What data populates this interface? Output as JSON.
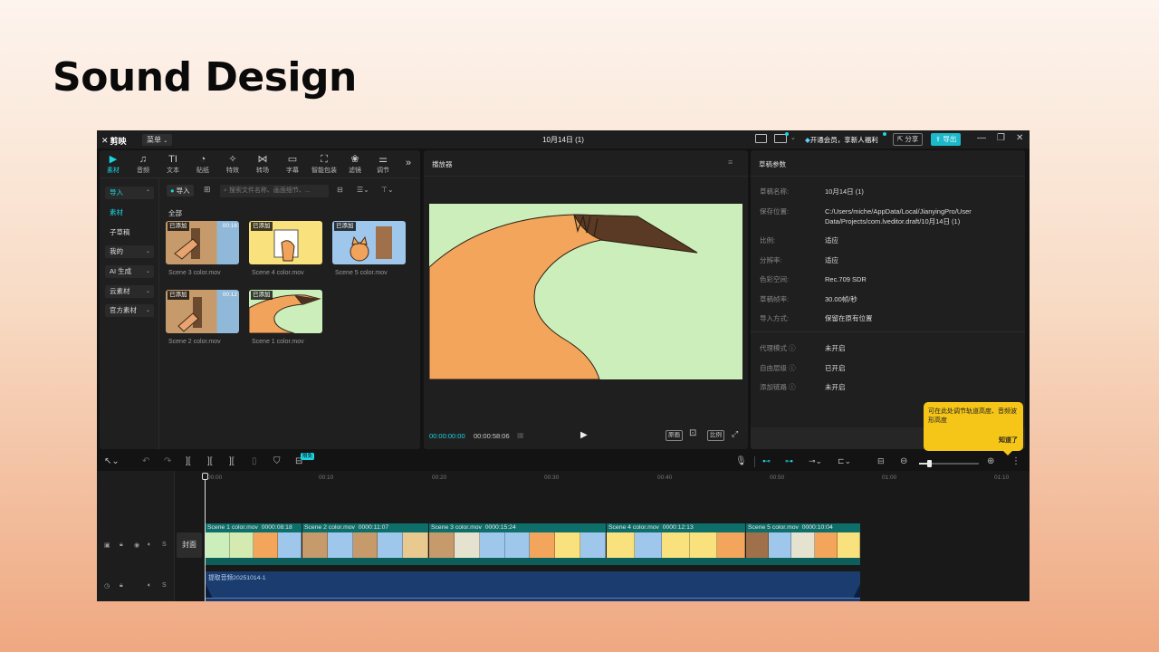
{
  "slide": {
    "title": "Sound Design"
  },
  "titlebar": {
    "app_name": "剪映",
    "menu_label": "菜单",
    "doc_title": "10月14日 (1)",
    "vip_label": "开通会员，享新人福利",
    "share_label": "分享",
    "export_label": "导出"
  },
  "toolbar": {
    "items": [
      {
        "label": "素材",
        "icon": "media-icon"
      },
      {
        "label": "音频",
        "icon": "audio-icon"
      },
      {
        "label": "文本",
        "icon": "text-icon"
      },
      {
        "label": "贴纸",
        "icon": "sticker-icon"
      },
      {
        "label": "特效",
        "icon": "effects-icon"
      },
      {
        "label": "转场",
        "icon": "transition-icon"
      },
      {
        "label": "字幕",
        "icon": "subtitle-icon"
      },
      {
        "label": "智能包装",
        "icon": "smart-pack-icon"
      },
      {
        "label": "滤镜",
        "icon": "filter-icon"
      },
      {
        "label": "调节",
        "icon": "adjust-icon"
      }
    ]
  },
  "sidebar": {
    "items": [
      {
        "label": "导入"
      },
      {
        "label": "素材"
      },
      {
        "label": "子草稿"
      },
      {
        "label": "我的"
      },
      {
        "label": "AI 生成"
      },
      {
        "label": "云素材"
      },
      {
        "label": "官方素材"
      }
    ]
  },
  "media": {
    "import_label": "导入",
    "search_placeholder": "搜索文件名称、画面细节、...",
    "section_label": "全部",
    "added_badge": "已添加",
    "items": [
      {
        "name": "Scene 3 color.mov",
        "duration": "00:16"
      },
      {
        "name": "Scene 4 color.mov",
        "duration": ""
      },
      {
        "name": "Scene 5 color.mov",
        "duration": ""
      },
      {
        "name": "Scene 2 color.mov",
        "duration": "00:12"
      },
      {
        "name": "Scene 1 color.mov",
        "duration": ""
      }
    ]
  },
  "player": {
    "title": "播放器",
    "current_time": "00:00:00:00",
    "total_time": "00:00:58:06",
    "quality_label": "原画",
    "ratio_label": "比例"
  },
  "properties": {
    "title": "草稿参数",
    "rows": [
      {
        "label": "草稿名称:",
        "value": "10月14日 (1)"
      },
      {
        "label": "保存位置:",
        "value": "C:/Users/miche/AppData/Local/JianyingPro/User Data/Projects/com.lveditor.draft/10月14日 (1)"
      },
      {
        "label": "比例:",
        "value": "适应"
      },
      {
        "label": "分辨率:",
        "value": "适应"
      },
      {
        "label": "色彩空间:",
        "value": "Rec.709 SDR"
      },
      {
        "label": "草稿帧率:",
        "value": "30.00帧/秒"
      },
      {
        "label": "导入方式:",
        "value": "保留在原有位置"
      },
      {
        "label": "代理模式",
        "value": "未开启"
      },
      {
        "label": "自由层级",
        "value": "已开启"
      },
      {
        "label": "添加链路",
        "value": "未开启"
      }
    ]
  },
  "tooltip": {
    "text": "可在此处调节轨道高度、音频波形高度",
    "confirm": "知道了"
  },
  "timeline": {
    "new_badge": "限免",
    "ruler": [
      "00:00",
      "00:10",
      "00:20",
      "00:30",
      "00:40",
      "00:50",
      "01:00",
      "01:10"
    ],
    "cover_label": "封面",
    "clips": [
      {
        "name": "Scene 1 color.mov",
        "duration": "0000:08:18"
      },
      {
        "name": "Scene 2 color.mov",
        "duration": "0000:11:07"
      },
      {
        "name": "Scene 3 color.mov",
        "duration": "0000:15:24"
      },
      {
        "name": "Scene 4 color.mov",
        "duration": "0000:12:13"
      },
      {
        "name": "Scene 5 color.mov",
        "duration": "0000:10:04"
      }
    ],
    "audio_clip": "提取音频20251014-1"
  }
}
